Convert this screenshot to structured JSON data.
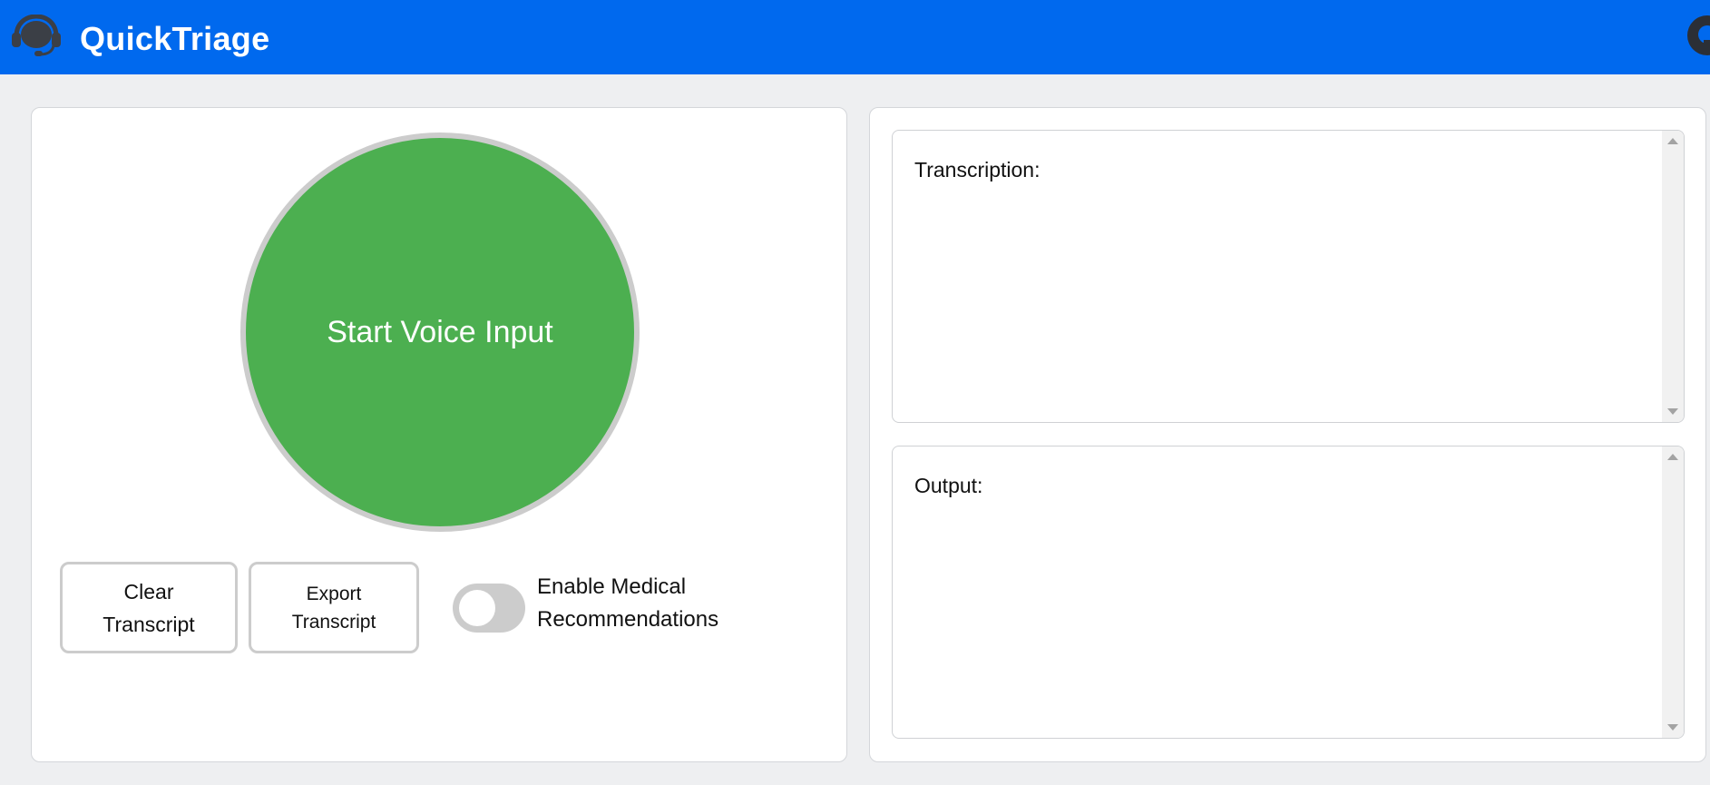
{
  "header": {
    "title": "QuickTriage",
    "logo_icon": "headset-icon",
    "corner_icon": "github-icon",
    "background_color": "#0069ee"
  },
  "controls": {
    "voice_button_label": "Start Voice Input",
    "voice_button_color": "#4caf50",
    "clear_button": [
      "Clear",
      "Transcript"
    ],
    "export_button": [
      "Export",
      "Transcript"
    ],
    "toggle": {
      "label": [
        "Enable Medical",
        "Recommendations"
      ],
      "checked": false
    }
  },
  "transcription": {
    "label": "Transcription:",
    "value": ""
  },
  "output": {
    "label": "Output:",
    "value": ""
  }
}
